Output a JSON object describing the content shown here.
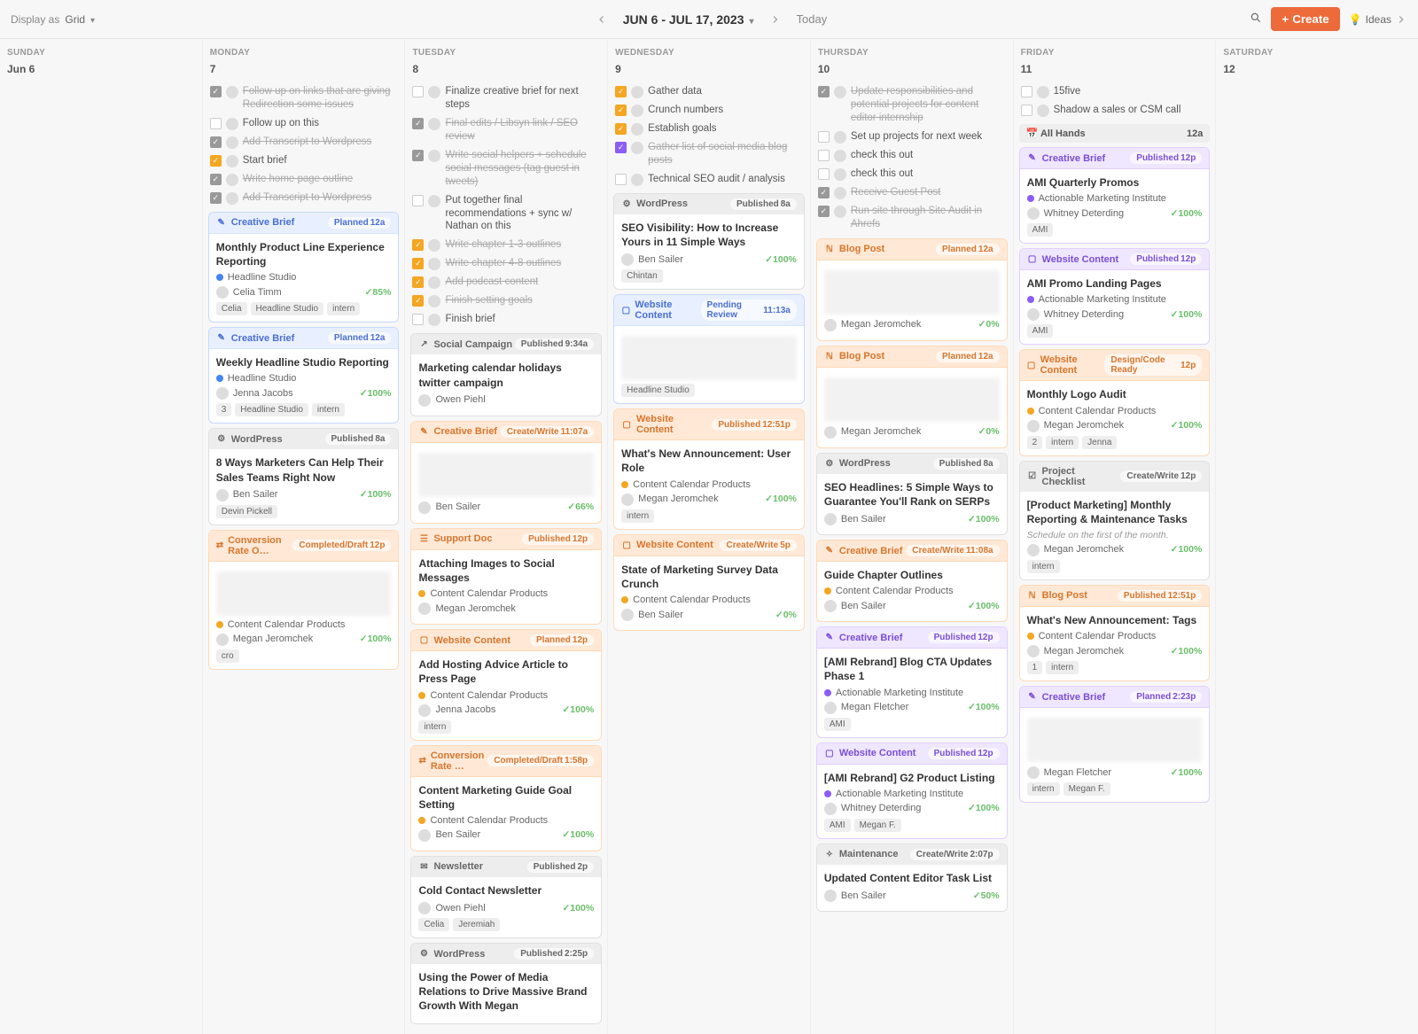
{
  "topbar": {
    "display_label": "Display as",
    "display_value": "Grid",
    "date_range": "JUN 6 - JUL 17, 2023",
    "today": "Today",
    "create": "Create",
    "ideas": "Ideas"
  },
  "days": [
    {
      "name": "SUNDAY",
      "num": "Jun 6",
      "tasks": [],
      "cards": []
    },
    {
      "name": "MONDAY",
      "num": "7",
      "tasks": [
        {
          "cb": "gray",
          "done": true,
          "text": "Follow up on links that are giving Redirection some issues"
        },
        {
          "cb": "empty",
          "done": false,
          "text": "Follow up on this"
        },
        {
          "cb": "gray",
          "done": true,
          "text": "Add Transcript to Wordpress"
        },
        {
          "cb": "orange",
          "done": false,
          "text": "Start brief"
        },
        {
          "cb": "gray",
          "done": true,
          "text": "Write home page outline"
        },
        {
          "cb": "gray",
          "done": true,
          "text": "Add Transcript to Wordpress"
        }
      ],
      "cards": [
        {
          "theme": "blue",
          "type_icon": "✎",
          "type": "Creative Brief",
          "status": "Planned",
          "time": "12a",
          "title": "Monthly Product Line Experience Reporting",
          "product": {
            "dot": "blue",
            "name": "Headline Studio"
          },
          "owner": "Celia Timm",
          "pct": "85%",
          "tags": [
            "Celia",
            "Headline Studio",
            "intern"
          ]
        },
        {
          "theme": "blue",
          "type_icon": "✎",
          "type": "Creative Brief",
          "status": "Planned",
          "time": "12a",
          "title": "Weekly Headline Studio Reporting",
          "product": {
            "dot": "blue",
            "name": "Headline Studio"
          },
          "owner": "Jenna Jacobs",
          "pct": "100%",
          "tags": [
            "3",
            "Headline Studio",
            "intern"
          ]
        },
        {
          "theme": "gray",
          "type_icon": "⚙",
          "type": "WordPress",
          "status": "Published",
          "time": "8a",
          "title": "8 Ways Marketers Can Help Their Sales Teams Right Now",
          "owner": "Ben Sailer",
          "pct": "100%",
          "tags": [
            "Devin Pickell"
          ]
        },
        {
          "theme": "orange",
          "type_icon": "⇄",
          "type": "Conversion Rate O…",
          "status": "Completed/Draft",
          "time": "12p",
          "blur": true,
          "product": {
            "dot": "orange",
            "name": "Content Calendar Products"
          },
          "owner": "Megan Jeromchek",
          "pct": "100%",
          "tags": [
            "cro"
          ]
        }
      ]
    },
    {
      "name": "TUESDAY",
      "num": "8",
      "tasks": [
        {
          "cb": "empty",
          "done": false,
          "text": "Finalize creative brief for next steps"
        },
        {
          "cb": "gray",
          "done": true,
          "text": "Final edits / Libsyn link / SEO review"
        },
        {
          "cb": "gray",
          "done": true,
          "text": "Write social helpers + schedule social messages (tag guest in tweets)"
        },
        {
          "cb": "empty",
          "done": false,
          "text": "Put together final recommendations + sync w/ Nathan on this"
        },
        {
          "cb": "orange",
          "done": true,
          "text": "Write chapter 1-3 outlines"
        },
        {
          "cb": "orange",
          "done": true,
          "text": "Write chapter 4-8 outlines"
        },
        {
          "cb": "orange",
          "done": true,
          "text": "Add podcast content"
        },
        {
          "cb": "orange",
          "done": true,
          "text": "Finish setting goals"
        },
        {
          "cb": "empty",
          "done": false,
          "text": "Finish brief"
        }
      ],
      "cards": [
        {
          "theme": "gray",
          "type_icon": "↗",
          "type": "Social Campaign",
          "status": "Published",
          "time": "9:34a",
          "title": "Marketing calendar holidays twitter campaign",
          "owner": "Owen Piehl"
        },
        {
          "theme": "orange",
          "type_icon": "✎",
          "type": "Creative Brief",
          "status": "Create/Write",
          "time": "11:07a",
          "blur": true,
          "owner": "Ben Sailer",
          "pct": "66%"
        },
        {
          "theme": "orange",
          "type_icon": "☰",
          "type": "Support Doc",
          "status": "Published",
          "time": "12p",
          "title": "Attaching Images to Social Messages",
          "product": {
            "dot": "orange",
            "name": "Content Calendar Products"
          },
          "owner": "Megan Jeromchek"
        },
        {
          "theme": "orange",
          "type_icon": "▢",
          "type": "Website Content",
          "status": "Planned",
          "time": "12p",
          "title": "Add Hosting Advice Article to Press Page",
          "product": {
            "dot": "orange",
            "name": "Content Calendar Products"
          },
          "owner": "Jenna Jacobs",
          "pct": "100%",
          "tags": [
            "intern"
          ]
        },
        {
          "theme": "orange",
          "type_icon": "⇄",
          "type": "Conversion Rate …",
          "status": "Completed/Draft",
          "time": "1:58p",
          "title": "Content Marketing Guide Goal Setting",
          "product": {
            "dot": "orange",
            "name": "Content Calendar Products"
          },
          "owner": "Ben Sailer",
          "pct": "100%"
        },
        {
          "theme": "gray",
          "type_icon": "✉",
          "type": "Newsletter",
          "status": "Published",
          "time": "2p",
          "title": "Cold Contact Newsletter",
          "owner": "Owen Piehl",
          "pct": "100%",
          "tags": [
            "Celia",
            "Jeremiah"
          ]
        },
        {
          "theme": "gray",
          "type_icon": "⚙",
          "type": "WordPress",
          "status": "Published",
          "time": "2:25p",
          "title": "Using the Power of Media Relations to Drive Massive Brand Growth With Megan"
        }
      ]
    },
    {
      "name": "WEDNESDAY",
      "num": "9",
      "tasks": [
        {
          "cb": "orange",
          "done": false,
          "text": "Gather data"
        },
        {
          "cb": "orange",
          "done": false,
          "text": "Crunch numbers"
        },
        {
          "cb": "orange",
          "done": false,
          "text": "Establish goals"
        },
        {
          "cb": "purple",
          "done": true,
          "text": "Gather list of social media blog posts"
        },
        {
          "cb": "empty",
          "done": false,
          "text": "Technical SEO audit / analysis"
        }
      ],
      "cards": [
        {
          "theme": "gray",
          "type_icon": "⚙",
          "type": "WordPress",
          "status": "Published",
          "time": "8a",
          "title": "SEO Visibility: How to Increase Yours in 11 Simple Ways",
          "owner": "Ben Sailer",
          "pct": "100%",
          "tags": [
            "Chintan"
          ]
        },
        {
          "theme": "blue",
          "type_icon": "▢",
          "type": "Website Content",
          "status": "Pending Review",
          "time": "11:13a",
          "blur": true,
          "tags": [
            "Headline Studio"
          ]
        },
        {
          "theme": "orange",
          "type_icon": "▢",
          "type": "Website Content",
          "status": "Published",
          "time": "12:51p",
          "title": "What's New Announcement: User Role",
          "product": {
            "dot": "orange",
            "name": "Content Calendar Products"
          },
          "owner": "Megan Jeromchek",
          "pct": "100%",
          "tags": [
            "intern"
          ]
        },
        {
          "theme": "orange",
          "type_icon": "▢",
          "type": "Website Content",
          "status": "Create/Write",
          "time": "5p",
          "title": "State of Marketing Survey Data Crunch",
          "product": {
            "dot": "orange",
            "name": "Content Calendar Products"
          },
          "owner": "Ben Sailer",
          "pct": "0%"
        }
      ]
    },
    {
      "name": "THURSDAY",
      "num": "10",
      "tasks": [
        {
          "cb": "gray",
          "done": true,
          "text": "Update responsibilities and potential projects for content editor internship"
        },
        {
          "cb": "empty",
          "done": false,
          "text": "Set up projects for next week"
        },
        {
          "cb": "empty",
          "done": false,
          "text": "check this out"
        },
        {
          "cb": "empty",
          "done": false,
          "text": "check this out"
        },
        {
          "cb": "gray",
          "done": true,
          "text": "Receive Guest Post"
        },
        {
          "cb": "gray",
          "done": true,
          "text": "Run site through Site Audit in Ahrefs"
        }
      ],
      "cards": [
        {
          "theme": "orange",
          "type_icon": "ℕ",
          "type": "Blog Post",
          "status": "Planned",
          "time": "12a",
          "blur": true,
          "owner": "Megan Jeromchek",
          "pct": "0%"
        },
        {
          "theme": "orange",
          "type_icon": "ℕ",
          "type": "Blog Post",
          "status": "Planned",
          "time": "12a",
          "blur": true,
          "owner": "Megan Jeromchek",
          "pct": "0%"
        },
        {
          "theme": "gray",
          "type_icon": "⚙",
          "type": "WordPress",
          "status": "Published",
          "time": "8a",
          "title": "SEO Headlines: 5 Simple Ways to Guarantee You'll Rank on SERPs",
          "owner": "Ben Sailer",
          "pct": "100%"
        },
        {
          "theme": "orange",
          "type_icon": "✎",
          "type": "Creative Brief",
          "status": "Create/Write",
          "time": "11:08a",
          "title": "Guide Chapter Outlines",
          "product": {
            "dot": "orange",
            "name": "Content Calendar Products"
          },
          "owner": "Ben Sailer",
          "pct": "100%"
        },
        {
          "theme": "purple",
          "type_icon": "✎",
          "type": "Creative Brief",
          "status": "Published",
          "time": "12p",
          "title": "[AMI Rebrand] Blog CTA Updates Phase 1",
          "product": {
            "dot": "purple",
            "name": "Actionable Marketing Institute"
          },
          "owner": "Megan Fletcher",
          "pct": "100%",
          "tags": [
            "AMI"
          ]
        },
        {
          "theme": "purple",
          "type_icon": "▢",
          "type": "Website Content",
          "status": "Published",
          "time": "12p",
          "title": "[AMI Rebrand] G2 Product Listing",
          "product": {
            "dot": "purple",
            "name": "Actionable Marketing Institute"
          },
          "owner": "Whitney Deterding",
          "pct": "100%",
          "tags": [
            "AMI",
            "Megan F."
          ]
        },
        {
          "theme": "gray",
          "type_icon": "✧",
          "type": "Maintenance",
          "status": "Create/Write",
          "time": "2:07p",
          "title": "Updated Content Editor Task List",
          "owner": "Ben Sailer",
          "pct": "50%"
        }
      ]
    },
    {
      "name": "FRIDAY",
      "num": "11",
      "tasks": [
        {
          "cb": "empty",
          "done": false,
          "text": "15five"
        },
        {
          "cb": "empty",
          "done": false,
          "text": "Shadow a sales or CSM call"
        }
      ],
      "allhands": {
        "label": "All Hands",
        "time": "12a"
      },
      "cards": [
        {
          "theme": "purple",
          "type_icon": "✎",
          "type": "Creative Brief",
          "status": "Published",
          "time": "12p",
          "title": "AMI Quarterly Promos",
          "product": {
            "dot": "purple",
            "name": "Actionable Marketing Institute"
          },
          "owner": "Whitney Deterding",
          "pct": "100%",
          "tags": [
            "AMI"
          ]
        },
        {
          "theme": "purple",
          "type_icon": "▢",
          "type": "Website Content",
          "status": "Published",
          "time": "12p",
          "title": "AMI Promo Landing Pages",
          "product": {
            "dot": "purple",
            "name": "Actionable Marketing Institute"
          },
          "owner": "Whitney Deterding",
          "pct": "100%",
          "tags": [
            "AMI"
          ]
        },
        {
          "theme": "orange",
          "type_icon": "▢",
          "type": "Website Content",
          "status": "Design/Code Ready",
          "time": "12p",
          "title": "Monthly Logo Audit",
          "product": {
            "dot": "orange",
            "name": "Content Calendar Products"
          },
          "owner": "Megan Jeromchek",
          "pct": "100%",
          "tags": [
            "2",
            "intern",
            "Jenna"
          ]
        },
        {
          "theme": "gray",
          "type_icon": "☑",
          "type": "Project Checklist",
          "status": "Create/Write",
          "time": "12p",
          "title": "[Product Marketing] Monthly Reporting & Maintenance Tasks",
          "note": "Schedule on the first of the month.",
          "owner": "Megan Jeromchek",
          "pct": "100%",
          "tags": [
            "intern"
          ]
        },
        {
          "theme": "orange",
          "type_icon": "ℕ",
          "type": "Blog Post",
          "status": "Published",
          "time": "12:51p",
          "title": "What's New Announcement: Tags",
          "product": {
            "dot": "orange",
            "name": "Content Calendar Products"
          },
          "owner": "Megan Jeromchek",
          "pct": "100%",
          "tags": [
            "1",
            "intern"
          ]
        },
        {
          "theme": "purple",
          "type_icon": "✎",
          "type": "Creative Brief",
          "status": "Planned",
          "time": "2:23p",
          "blur": true,
          "owner": "Megan Fletcher",
          "pct": "100%",
          "tags": [
            "intern",
            "Megan F."
          ]
        }
      ]
    },
    {
      "name": "SATURDAY",
      "num": "12",
      "tasks": [],
      "cards": []
    }
  ]
}
